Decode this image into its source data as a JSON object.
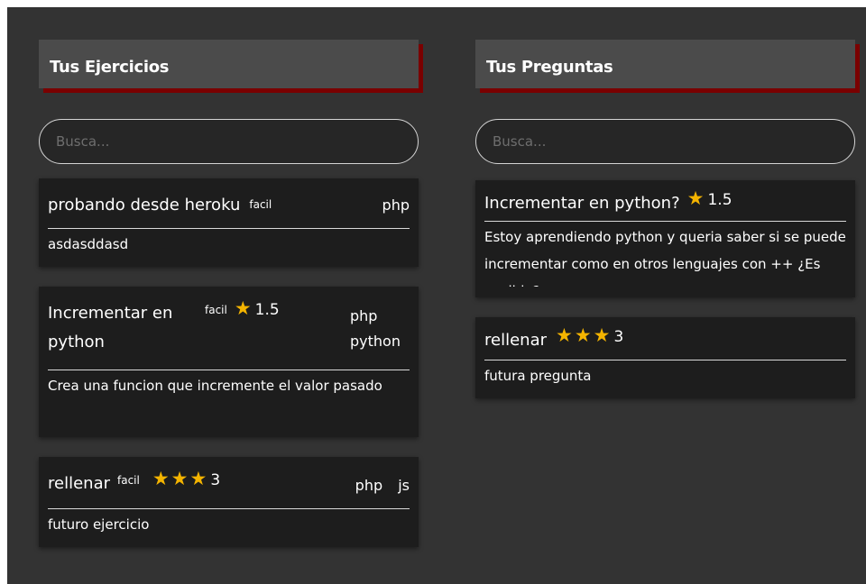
{
  "ejercicios": {
    "title": "Tus Ejercicios",
    "search_placeholder": "Busca...",
    "items": [
      {
        "title": "probando desde heroku",
        "level": "facil",
        "tags": [
          "php"
        ],
        "description": "asdasddasd"
      },
      {
        "title": "Incrementar en python",
        "level": "facil",
        "stars": 1,
        "rating": "1.5",
        "tags": [
          "php",
          "python"
        ],
        "description": "Crea una funcion que incremente el valor pasado"
      },
      {
        "title": "rellenar",
        "level": "facil",
        "stars": 3,
        "rating": "3",
        "tags": [
          "php",
          "js"
        ],
        "description": "futuro ejercicio"
      }
    ]
  },
  "preguntas": {
    "title": "Tus Preguntas",
    "search_placeholder": "Busca...",
    "items": [
      {
        "title": "Incrementar en python?",
        "stars": 1,
        "rating": "1.5",
        "description": "Estoy aprendiendo python y queria saber si se puede incrementar como en otros lenguajes con ++ ¿Es posible?"
      },
      {
        "title": "rellenar",
        "stars": 3,
        "rating": "3",
        "description": "futura pregunta"
      }
    ]
  },
  "colors": {
    "background": "#333333",
    "header": "#4b4b4b",
    "header_shadow": "#7a0000",
    "card": "#1d1d1d",
    "star": "#f4b400"
  },
  "icons": {
    "star": "star-icon"
  }
}
